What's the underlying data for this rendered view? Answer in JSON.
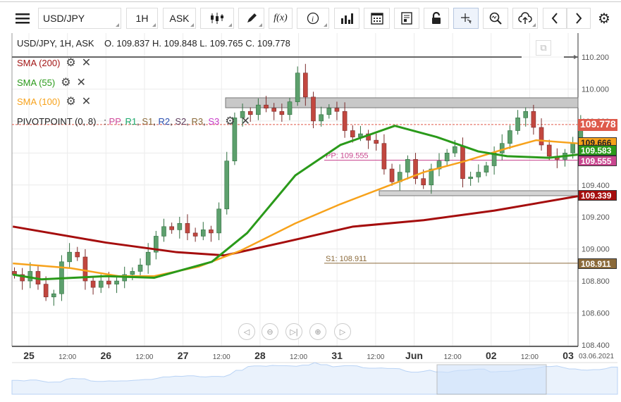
{
  "toolbar": {
    "symbol": "USD/JPY",
    "timeframe": "1H",
    "price_side": "ASK",
    "fx_label": "f(x)",
    "icons": [
      "menu-icon",
      "candlestick-icon",
      "pencil-icon",
      "function-icon",
      "info-icon",
      "bar-chart-icon",
      "calendar-icon",
      "report-icon",
      "lock-icon",
      "crosshair-icon",
      "zoom-icon",
      "upload-cloud-icon",
      "chevron-left-icon",
      "chevron-right-icon",
      "gear-icon"
    ]
  },
  "header": {
    "info": "USD/JPY, 1H, ASK",
    "ohlc": "O. 109.837 H. 109.848 L. 109.765 C. 109.778"
  },
  "indicators": [
    {
      "label": "SMA (200)",
      "color": "#a31515"
    },
    {
      "label": "SMA (55)",
      "color": "#2a9a1a"
    },
    {
      "label": "SMA (100)",
      "color": "#f7a21b"
    }
  ],
  "pivot": {
    "label": "PIVOTPOINT (0, 8)",
    "sep": ":",
    "levels": [
      {
        "name": "PP",
        "color": "#d04a9a"
      },
      {
        "name": "R1",
        "color": "#1aa86a"
      },
      {
        "name": "S1",
        "color": "#8b6a3a"
      },
      {
        "name": "R2",
        "color": "#2a4fb0"
      },
      {
        "name": "S2",
        "color": "#5a3a5a"
      },
      {
        "name": "R3",
        "color": "#8b6a3a"
      },
      {
        "name": "S3",
        "color": "#c83ac8"
      }
    ]
  },
  "annotations": {
    "pp": "PP: 109.555",
    "s1": "S1: 108.911"
  },
  "price_axis": [
    "110.200",
    "110.000",
    "109.800",
    "109.600",
    "109.400",
    "109.200",
    "109.000",
    "108.800",
    "108.600",
    "108.400"
  ],
  "price_labels": [
    {
      "value": "109.778",
      "bg": "#de5a4b",
      "fg": "#fff"
    },
    {
      "value": "109.666",
      "bg": "#f7a21b",
      "fg": "#222"
    },
    {
      "value": "109.583",
      "bg": "#2a9a1a",
      "fg": "#fff"
    },
    {
      "value": "109.555",
      "bg": "#c8468f",
      "fg": "#fff"
    },
    {
      "value": "109.339",
      "bg": "#a50d0d",
      "fg": "#fff"
    },
    {
      "value": "108.911",
      "bg": "#8b6a3a",
      "fg": "#fff"
    }
  ],
  "time_axis": [
    {
      "label": "25",
      "major": true,
      "h": 0
    },
    {
      "label": "12:00",
      "h": 12
    },
    {
      "label": "26",
      "major": true,
      "h": 24
    },
    {
      "label": "12:00",
      "h": 36
    },
    {
      "label": "27",
      "major": true,
      "h": 48
    },
    {
      "label": "12:00",
      "h": 60
    },
    {
      "label": "28",
      "major": true,
      "h": 72
    },
    {
      "label": "12:00",
      "h": 84
    },
    {
      "label": "31",
      "major": true,
      "h": 96
    },
    {
      "label": "12:00",
      "h": 108
    },
    {
      "label": "Jun",
      "major": true,
      "h": 120
    },
    {
      "label": "12:00",
      "h": 132
    },
    {
      "label": "02",
      "major": true,
      "h": 144
    },
    {
      "label": "12:00",
      "h": 156
    },
    {
      "label": "03",
      "major": true,
      "h": 168
    }
  ],
  "date_label": "03.06.2021",
  "chart_data": {
    "type": "candlestick",
    "start_hour": -4.5,
    "step_hours": 2.45,
    "closes": [
      108.84,
      108.8,
      108.86,
      108.78,
      108.7,
      108.72,
      108.92,
      108.98,
      108.95,
      108.8,
      108.76,
      108.8,
      108.78,
      108.8,
      108.84,
      108.86,
      108.9,
      108.98,
      109.08,
      109.14,
      109.12,
      109.16,
      109.1,
      109.08,
      109.12,
      109.1,
      109.25,
      109.55,
      109.82,
      109.86,
      109.84,
      109.9,
      109.88,
      109.86,
      109.84,
      109.92,
      110.1,
      109.95,
      109.8,
      109.84,
      109.88,
      109.86,
      109.74,
      109.7,
      109.72,
      109.68,
      109.66,
      109.5,
      109.42,
      109.48,
      109.56,
      109.44,
      109.4,
      109.5,
      109.55,
      109.6,
      109.64,
      109.44,
      109.45,
      109.48,
      109.52,
      109.6,
      109.66,
      109.74,
      109.82,
      109.86,
      109.76,
      109.65,
      109.58,
      109.56,
      109.6,
      109.66,
      109.78
    ],
    "sma200": [
      [
        -5,
        109.14
      ],
      [
        24,
        109.04
      ],
      [
        46,
        108.98
      ],
      [
        61,
        108.96
      ],
      [
        79,
        109.04
      ],
      [
        101,
        109.14
      ],
      [
        123,
        109.18
      ],
      [
        145,
        109.24
      ],
      [
        171,
        109.33
      ]
    ],
    "sma55": [
      [
        -5,
        108.84
      ],
      [
        4,
        108.81
      ],
      [
        24,
        108.83
      ],
      [
        39,
        108.82
      ],
      [
        57,
        108.92
      ],
      [
        68,
        109.1
      ],
      [
        83,
        109.46
      ],
      [
        97,
        109.65
      ],
      [
        114,
        109.77
      ],
      [
        127,
        109.7
      ],
      [
        140,
        109.61
      ],
      [
        149,
        109.58
      ],
      [
        162,
        109.57
      ],
      [
        171,
        109.59
      ]
    ],
    "sma100": [
      [
        -5,
        108.91
      ],
      [
        13,
        108.88
      ],
      [
        28,
        108.83
      ],
      [
        39,
        108.83
      ],
      [
        53,
        108.89
      ],
      [
        66,
        108.99
      ],
      [
        83,
        109.16
      ],
      [
        97,
        109.28
      ],
      [
        110,
        109.38
      ],
      [
        123,
        109.48
      ],
      [
        136,
        109.55
      ],
      [
        149,
        109.63
      ],
      [
        158,
        109.68
      ],
      [
        171,
        109.66
      ]
    ],
    "levels": {
      "top": 110.2,
      "last": 109.778,
      "pp": 109.555,
      "s1": 108.911,
      "zone1": [
        109.883,
        109.945
      ],
      "zone2": [
        109.333,
        109.364
      ]
    },
    "ylim": [
      108.4,
      110.2
    ]
  },
  "navigator_buttons": [
    "scroll-left",
    "zoom-out",
    "reset",
    "zoom-in",
    "scroll-right"
  ]
}
